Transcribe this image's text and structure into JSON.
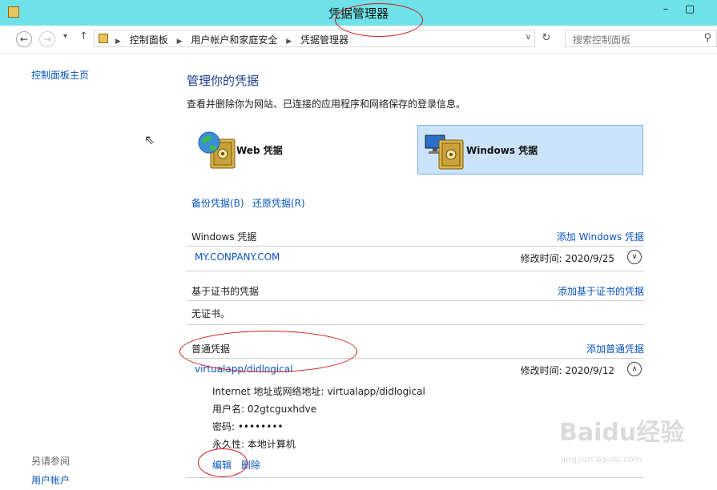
{
  "window": {
    "title": "凭据管理器",
    "minimize": "–",
    "restore": "▢"
  },
  "addressbar": {
    "crumbs": [
      "控制面板",
      "用户帐户和家庭安全",
      "凭据管理器"
    ],
    "search_placeholder": "搜索控制面板"
  },
  "leftnav": {
    "home": "控制面板主页",
    "see_also": "另请参阅",
    "user_accounts": "用户帐户"
  },
  "main": {
    "title": "管理你的凭据",
    "description": "查看并删除你为网站、已连接的应用程序和网络保存的登录信息。",
    "tiles": {
      "web": "Web 凭据",
      "windows": "Windows 凭据",
      "selected": "windows"
    },
    "backup": "备份凭据(B)",
    "restore": "还原凭据(R)",
    "windows_section": {
      "title": "Windows 凭据",
      "add": "添加 Windows 凭据",
      "items": [
        {
          "name": "MY.CONPANY.COM",
          "modified": "修改时间: 2020/9/25"
        }
      ]
    },
    "cert_section": {
      "title": "基于证书的凭据",
      "add": "添加基于证书的凭据",
      "empty": "无证书。"
    },
    "generic_section": {
      "title": "普通凭据",
      "add": "添加普通凭据",
      "item": {
        "name": "virtualapp/didlogical",
        "modified": "修改时间: 2020/9/12",
        "address": "Internet 地址或网络地址: virtualapp/didlogical",
        "username": "用户名: 02gtcguxhdve",
        "password": "密码: ••••••••",
        "persistence": "永久性: 本地计算机",
        "edit": "编辑",
        "delete": "删除"
      }
    }
  },
  "watermark": {
    "logo": "Baidu经验",
    "url": "jingyan.baidu.com"
  },
  "colors": {
    "titlebar": "#6ee2e8",
    "link": "#0a55c2",
    "selected_tile": "#cce4fa",
    "annotation": "#d11a1a"
  }
}
